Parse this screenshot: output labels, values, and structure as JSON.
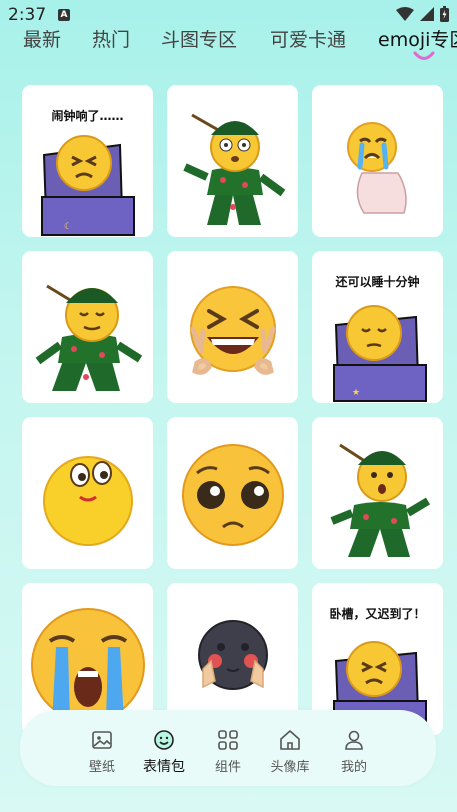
{
  "status_bar": {
    "time": "2:37",
    "app_badge": "A"
  },
  "tabs": [
    {
      "label": "最新"
    },
    {
      "label": "热门"
    },
    {
      "label": "斗图专区"
    },
    {
      "label": "可爱卡通"
    },
    {
      "label": "emoji专区"
    }
  ],
  "active_tab": "emoji专区",
  "stickers": [
    {
      "caption": "闹钟响了……",
      "kind": "bed-tired"
    },
    {
      "caption": "",
      "kind": "dancer-shocked"
    },
    {
      "caption": "",
      "kind": "crying-sitting"
    },
    {
      "caption": "",
      "kind": "dancer-calm"
    },
    {
      "caption": "",
      "kind": "laughing-peace"
    },
    {
      "caption": "还可以睡十分钟",
      "kind": "bed-sleepy"
    },
    {
      "caption": "",
      "kind": "smile-eyes"
    },
    {
      "caption": "",
      "kind": "pleading"
    },
    {
      "caption": "",
      "kind": "dancer-surprised"
    },
    {
      "caption": "",
      "kind": "big-crying"
    },
    {
      "caption": "",
      "kind": "dark-moon-blush"
    },
    {
      "caption": "卧槽，又迟到了！",
      "kind": "bed-late"
    }
  ],
  "bottom_nav": [
    {
      "label": "壁纸",
      "icon": "image-icon"
    },
    {
      "label": "表情包",
      "icon": "emoji-icon"
    },
    {
      "label": "组件",
      "icon": "widgets-icon"
    },
    {
      "label": "头像库",
      "icon": "home-icon"
    },
    {
      "label": "我的",
      "icon": "person-icon"
    }
  ],
  "active_nav": "表情包",
  "colors": {
    "accent": "#e06ad0",
    "card_bg": "#ffffff",
    "nav_bg": "#e9fbf8"
  }
}
